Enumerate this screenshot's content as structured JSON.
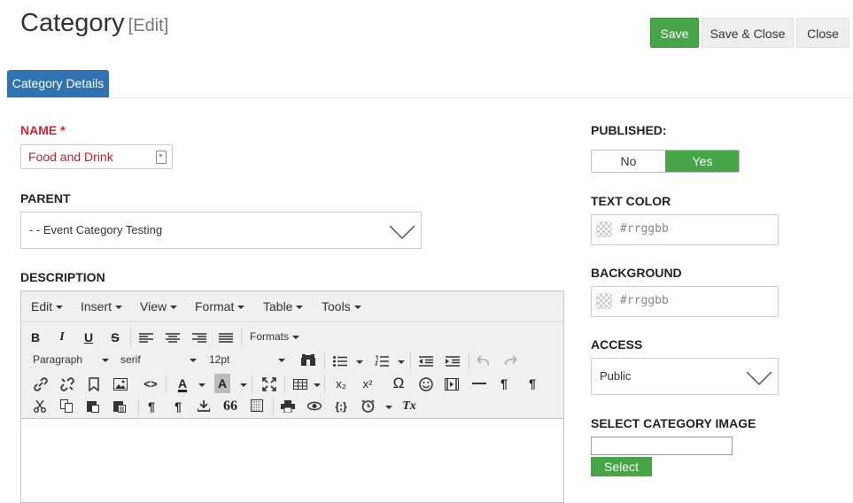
{
  "header": {
    "title": "Category",
    "subtitle": "[Edit]"
  },
  "toolbar": {
    "save_label": "Save",
    "save_close_label": "Save & Close",
    "close_label": "Close"
  },
  "tabs": [
    {
      "label": "Category Details"
    }
  ],
  "form": {
    "name_label": "NAME",
    "required_mark": "*",
    "name_value": "Food and Drink",
    "parent_label": "PARENT",
    "parent_value": "- - Event Category Testing",
    "description_label": "DESCRIPTION"
  },
  "editor": {
    "menus": [
      "Edit",
      "Insert",
      "View",
      "Format",
      "Table",
      "Tools"
    ],
    "formats_label": "Formats",
    "block_format": "Paragraph",
    "font_family": "serif",
    "font_size": "12pt",
    "buttons": {
      "bold": "B",
      "italic": "I",
      "underline": "U",
      "strike": "S",
      "subscript": "x₂",
      "superscript": "x²",
      "omega": "Ω",
      "code": "<>",
      "text_color": "A",
      "bg_color": "A",
      "source": "{;}",
      "clear": "Tx",
      "paragraph": "¶",
      "quote": "66"
    }
  },
  "sidebar": {
    "published_label": "PUBLISHED:",
    "published_no": "No",
    "published_yes": "Yes",
    "text_color_label": "TEXT COLOR",
    "text_color_placeholder": "#rrggbb",
    "background_label": "BACKGROUND",
    "background_placeholder": "#rrggbb",
    "access_label": "ACCESS",
    "access_value": "Public",
    "image_label": "SELECT CATEGORY IMAGE",
    "select_label": "Select"
  },
  "colors": {
    "accent": "#46a546",
    "tab": "#2f73b0",
    "required": "#d8202a"
  }
}
